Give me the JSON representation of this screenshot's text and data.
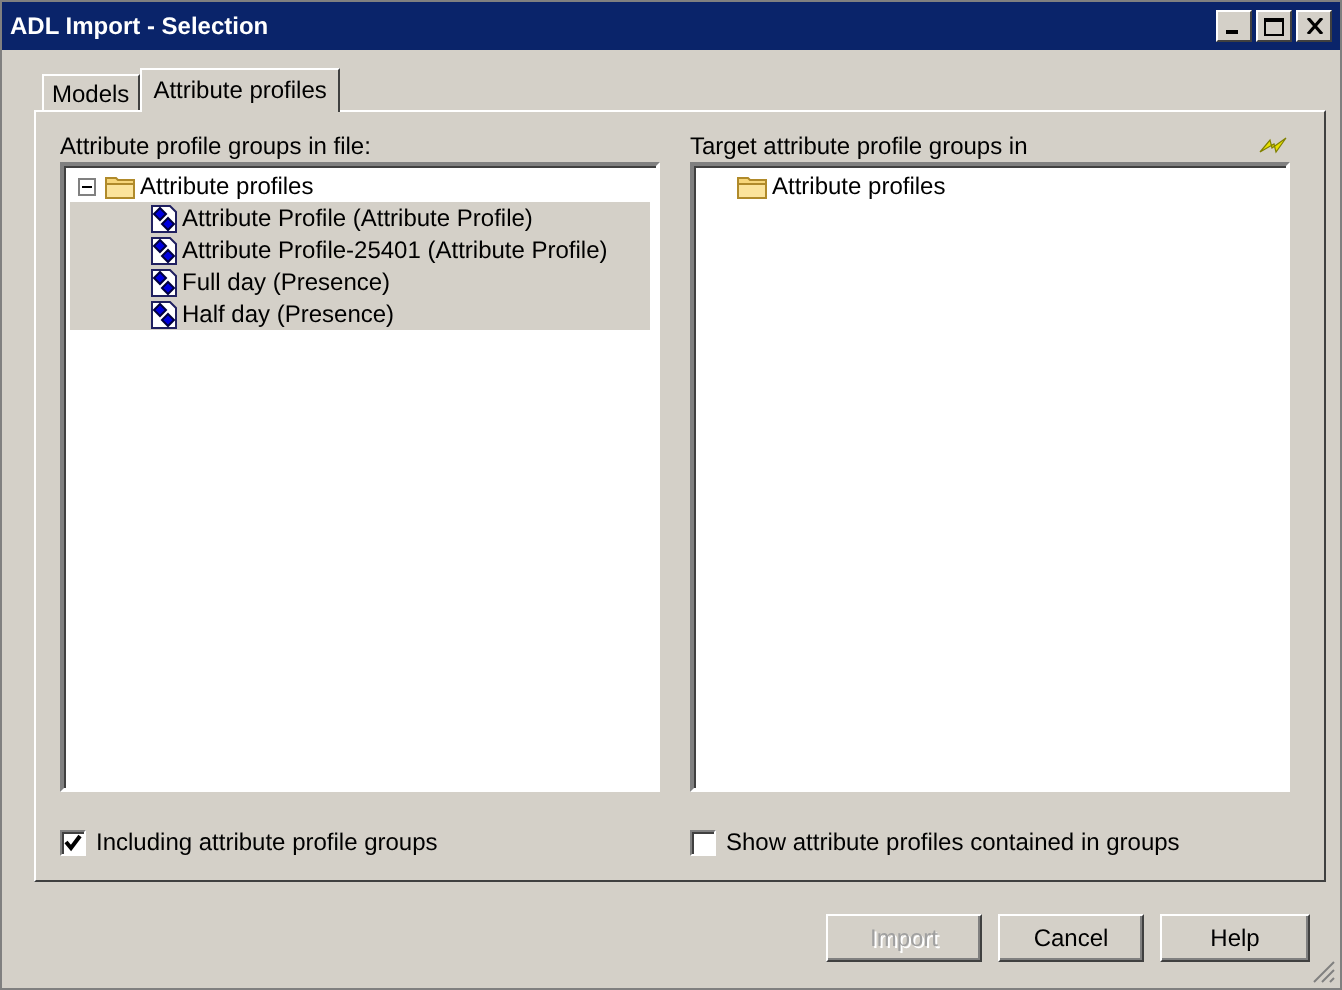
{
  "window": {
    "title": "ADL Import - Selection"
  },
  "tabs": [
    {
      "label": "Models",
      "selected": false
    },
    {
      "label": "Attribute profiles",
      "selected": true
    }
  ],
  "source_panel": {
    "label": "Attribute profile groups in file:",
    "tree": [
      {
        "kind": "folder",
        "label": "Attribute profiles",
        "expanded": true,
        "selected": false,
        "children": [
          {
            "kind": "profile",
            "label": "Attribute Profile (Attribute Profile)",
            "selected": true
          },
          {
            "kind": "profile",
            "label": "Attribute Profile-25401 (Attribute Profile)",
            "selected": true
          },
          {
            "kind": "profile",
            "label": "Full day (Presence)",
            "selected": true
          },
          {
            "kind": "profile",
            "label": "Half day (Presence)",
            "selected": true
          }
        ]
      }
    ]
  },
  "target_panel": {
    "label": "Target attribute profile groups in",
    "tree": [
      {
        "kind": "folder",
        "label": "Attribute profiles",
        "selected": false
      }
    ]
  },
  "options": [
    {
      "label": "Including attribute profile groups",
      "checked": true
    },
    {
      "label": "Show attribute profiles contained in groups",
      "checked": false
    }
  ],
  "buttons": [
    {
      "label": "Import",
      "disabled": true
    },
    {
      "label": "Cancel",
      "disabled": false
    },
    {
      "label": "Help",
      "disabled": false
    }
  ]
}
